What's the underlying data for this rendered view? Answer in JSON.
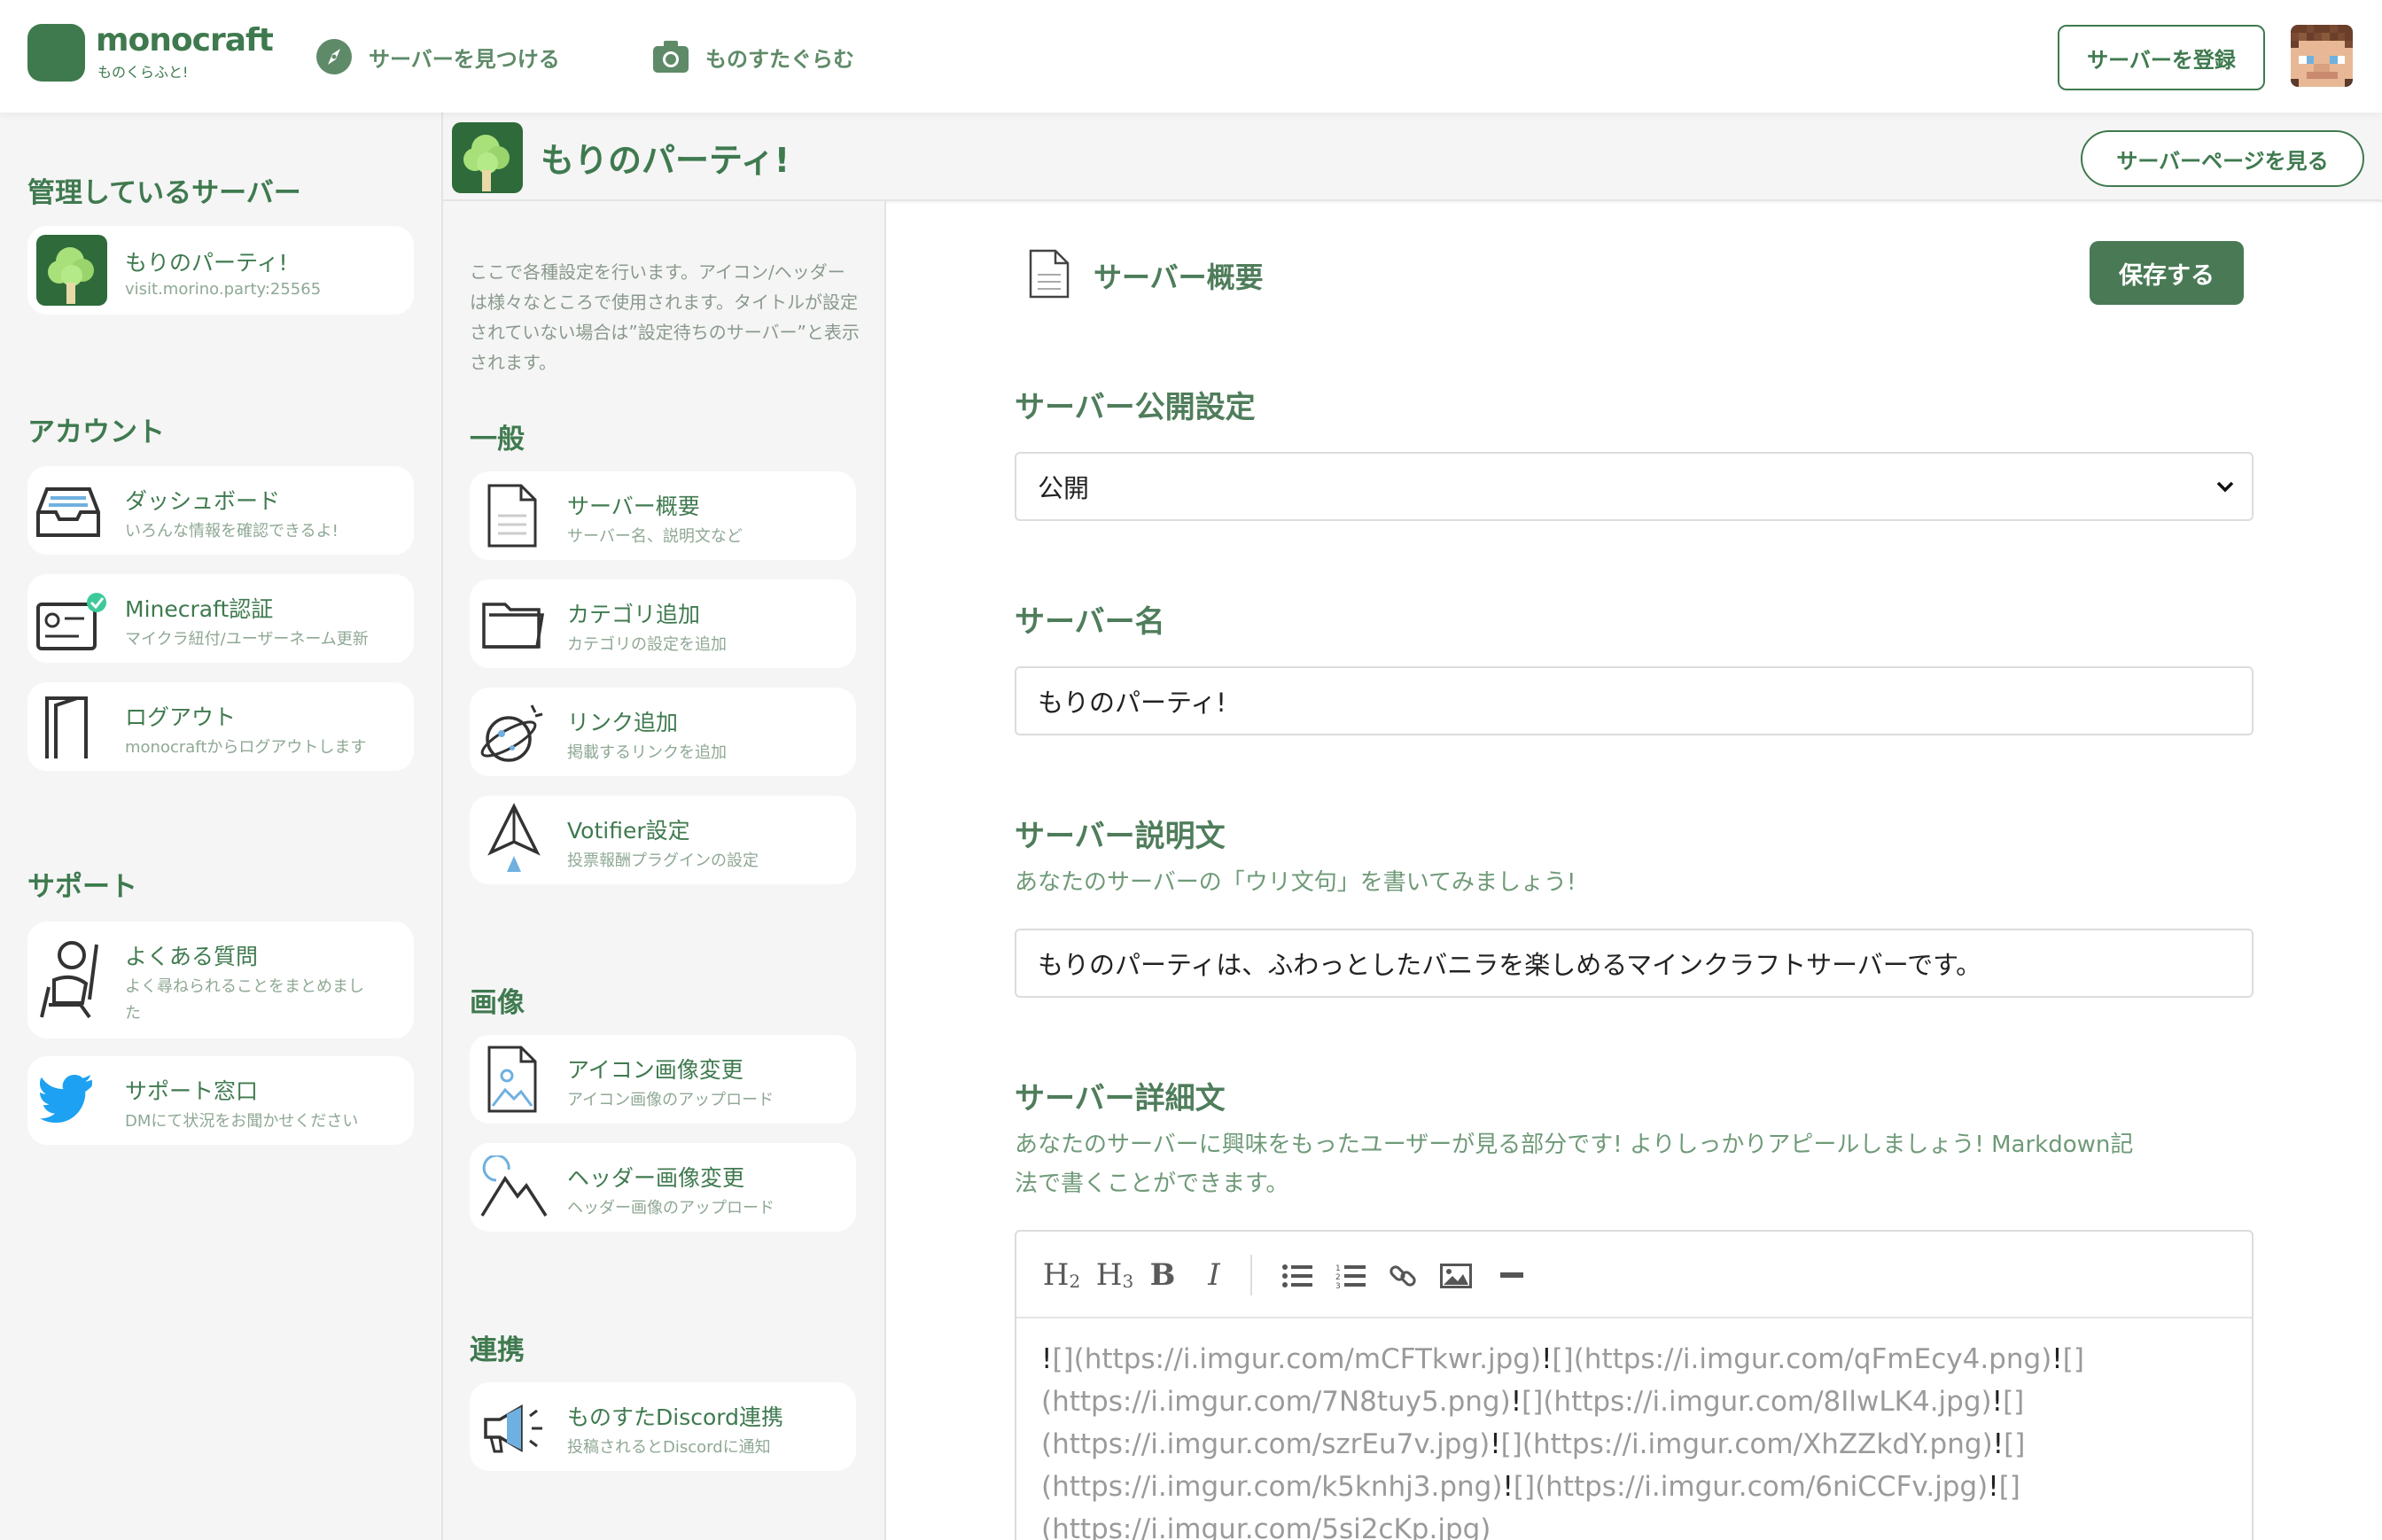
{
  "header": {
    "logo_text": "monocraft",
    "logo_sub": "ものくらふと!",
    "nav": [
      {
        "label": "サーバーを見つける",
        "icon": "compass-icon"
      },
      {
        "label": "ものすたぐらむ",
        "icon": "camera-icon"
      }
    ],
    "register_label": "サーバーを登録"
  },
  "sidebar": {
    "managed_title": "管理しているサーバー",
    "server": {
      "name": "もりのパーティ!",
      "address": "visit.morino.party:25565"
    },
    "account_title": "アカウント",
    "account_items": [
      {
        "label": "ダッシュボード",
        "sub": "いろんな情報を確認できるよ!",
        "icon": "inbox-icon"
      },
      {
        "label": "Minecraft認証",
        "sub": "マイクラ紐付/ユーザーネーム更新",
        "icon": "id-card-check-icon"
      },
      {
        "label": "ログアウト",
        "sub": "monocraftからログアウトします",
        "icon": "door-icon"
      }
    ],
    "support_title": "サポート",
    "support_items": [
      {
        "label": "よくある質問",
        "sub_line1": "よく尋ねられることをまとめまし",
        "sub_line2": "た",
        "icon": "person-chair-icon"
      },
      {
        "label": "サポート窓口",
        "sub": "DMにて状況をお聞かせください",
        "icon": "twitter-bird-icon"
      }
    ]
  },
  "settings_nav": {
    "description": "ここで各種設定を行います。アイコン/ヘッダーは様々なところで使用されます。タイトルが設定されていない場合は”設定待ちのサーバー”と表示されます。",
    "general_title": "一般",
    "general_items": [
      {
        "label": "サーバー概要",
        "sub": "サーバー名、説明文など",
        "icon": "document-icon"
      },
      {
        "label": "カテゴリ追加",
        "sub": "カテゴリの設定を追加",
        "icon": "folder-icon"
      },
      {
        "label": "リンク追加",
        "sub": "掲載するリンクを追加",
        "icon": "planet-icon"
      },
      {
        "label": "Votifier設定",
        "sub": "投票報酬プラグインの設定",
        "icon": "paper-plane-icon"
      }
    ],
    "image_title": "画像",
    "image_items": [
      {
        "label": "アイコン画像変更",
        "sub": "アイコン画像のアップロード",
        "icon": "image-file-icon"
      },
      {
        "label": "ヘッダー画像変更",
        "sub": "ヘッダー画像のアップロード",
        "icon": "mountain-icon"
      }
    ],
    "link_title": "連携",
    "link_items": [
      {
        "label": "ものすたDiscord連携",
        "sub": "投稿されるとDiscordに通知",
        "icon": "megaphone-icon"
      }
    ]
  },
  "server_bar": {
    "title": "もりのパーティ!",
    "view_label": "サーバーページを見る"
  },
  "main": {
    "section_title": "サーバー概要",
    "save_label": "保存する",
    "visibility_label": "サーバー公開設定",
    "visibility_value": "公開",
    "name_label": "サーバー名",
    "name_value": "もりのパーティ!",
    "desc_label": "サーバー説明文",
    "desc_hint": "あなたのサーバーの「ウリ文句」を書いてみましょう!",
    "desc_value": "もりのパーティは、ふわっとしたバニラを楽しめるマインクラフトサーバーです。",
    "detail_label": "サーバー詳細文",
    "detail_hint_line1": "あなたのサーバーに興味をもったユーザーが見る部分です! よりしっかりアピールしましょう! Markdown記",
    "detail_hint_line2": "法で書くことができます。",
    "toolbar": [
      "H2",
      "H3",
      "B",
      "I",
      "bullet-list",
      "numbered-list",
      "link",
      "image",
      "hr"
    ],
    "editor_lines": [
      [
        "(https://i.imgur.com/mCFTkwr.jpg)",
        "(https://i.imgur.com/qFmEcy4.png)"
      ],
      [
        "(https://i.imgur.com/7N8tuy5.png)",
        "(https://i.imgur.com/8IlwLK4.jpg)"
      ],
      [
        "(https://i.imgur.com/szrEu7v.jpg)",
        "(https://i.imgur.com/XhZZkdY.png)"
      ],
      [
        "(https://i.imgur.com/k5knhj3.png)",
        "(https://i.imgur.com/6niCCFv.jpg)"
      ],
      [
        "(https://i.imgur.com/5si2cKp.jpg)",
        ""
      ]
    ]
  },
  "colors": {
    "brand": "#3f7a4f",
    "save": "#4a7a55",
    "muted": "#8fa894"
  }
}
